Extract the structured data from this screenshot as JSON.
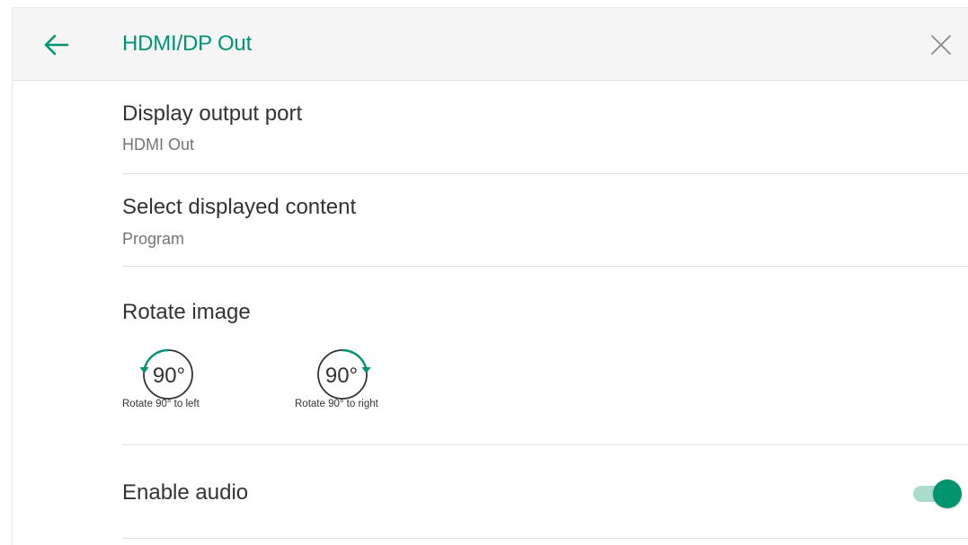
{
  "header": {
    "title": "HDMI/DP Out",
    "back_icon": "arrow-left-icon",
    "close_icon": "close-icon"
  },
  "settings": {
    "display_output_port": {
      "label": "Display output port",
      "value": "HDMI Out"
    },
    "select_displayed_content": {
      "label": "Select displayed content",
      "value": "Program"
    },
    "rotate_image": {
      "label": "Rotate image",
      "left": {
        "degrees": "90°",
        "caption": "Rotate 90° to left",
        "icon": "rotate-left-icon"
      },
      "right": {
        "degrees": "90°",
        "caption": "Rotate 90° to right",
        "icon": "rotate-right-icon"
      }
    },
    "enable_audio": {
      "label": "Enable audio",
      "enabled": true
    }
  },
  "colors": {
    "accent": "#009473",
    "toggle_track": "#a9dccd",
    "header_bg": "#f5f5f5",
    "text_primary": "#333333",
    "text_secondary": "#757575"
  }
}
